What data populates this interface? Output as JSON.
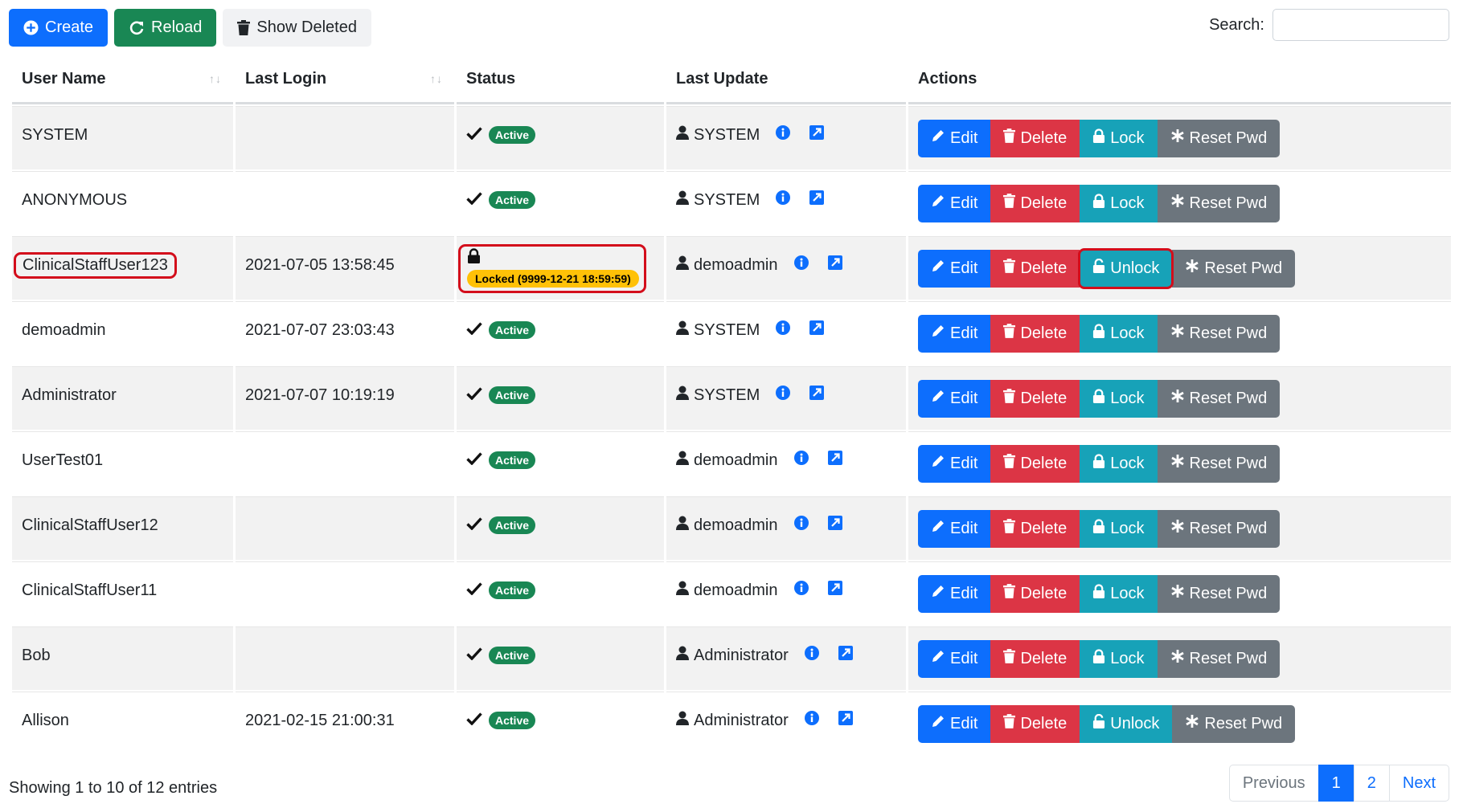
{
  "toolbar": {
    "create_label": "Create",
    "reload_label": "Reload",
    "show_deleted_label": "Show Deleted"
  },
  "search": {
    "label": "Search:",
    "value": "",
    "placeholder": ""
  },
  "table": {
    "columns": [
      "User Name",
      "Last Login",
      "Status",
      "Last Update",
      "Actions"
    ],
    "action_labels": {
      "edit": "Edit",
      "delete": "Delete",
      "lock": "Lock",
      "unlock": "Unlock",
      "reset": "Reset Pwd"
    },
    "rows": [
      {
        "user": "SYSTEM",
        "last_login": "",
        "status": "Active",
        "locked": false,
        "updated_by": "SYSTEM",
        "lock_action": "Lock"
      },
      {
        "user": "ANONYMOUS",
        "last_login": "",
        "status": "Active",
        "locked": false,
        "updated_by": "SYSTEM",
        "lock_action": "Lock"
      },
      {
        "user": "ClinicalStaffUser123",
        "last_login": "2021-07-05 13:58:45",
        "status": "Locked (9999-12-21 18:59:59)",
        "locked": true,
        "updated_by": "demoadmin",
        "lock_action": "Unlock",
        "highlighted": true
      },
      {
        "user": "demoadmin",
        "last_login": "2021-07-07 23:03:43",
        "status": "Active",
        "locked": false,
        "updated_by": "SYSTEM",
        "lock_action": "Lock"
      },
      {
        "user": "Administrator",
        "last_login": "2021-07-07 10:19:19",
        "status": "Active",
        "locked": false,
        "updated_by": "SYSTEM",
        "lock_action": "Lock"
      },
      {
        "user": "UserTest01",
        "last_login": "",
        "status": "Active",
        "locked": false,
        "updated_by": "demoadmin",
        "lock_action": "Lock"
      },
      {
        "user": "ClinicalStaffUser12",
        "last_login": "",
        "status": "Active",
        "locked": false,
        "updated_by": "demoadmin",
        "lock_action": "Lock"
      },
      {
        "user": "ClinicalStaffUser11",
        "last_login": "",
        "status": "Active",
        "locked": false,
        "updated_by": "demoadmin",
        "lock_action": "Lock"
      },
      {
        "user": "Bob",
        "last_login": "",
        "status": "Active",
        "locked": false,
        "updated_by": "Administrator",
        "lock_action": "Lock"
      },
      {
        "user": "Allison",
        "last_login": "2021-02-15 21:00:31",
        "status": "Active",
        "locked": false,
        "updated_by": "Administrator",
        "lock_action": "Unlock"
      }
    ]
  },
  "footer": {
    "info": "Showing 1 to 10 of 12 entries",
    "pagination": {
      "previous": "Previous",
      "pages": [
        "1",
        "2"
      ],
      "current": "1",
      "next": "Next"
    }
  },
  "colors": {
    "primary": "#0d6efd",
    "success": "#198754",
    "danger": "#dc3545",
    "info": "#17a2b8",
    "secondary": "#6c757d",
    "warning": "#ffc107",
    "highlight": "#d30d1b"
  }
}
